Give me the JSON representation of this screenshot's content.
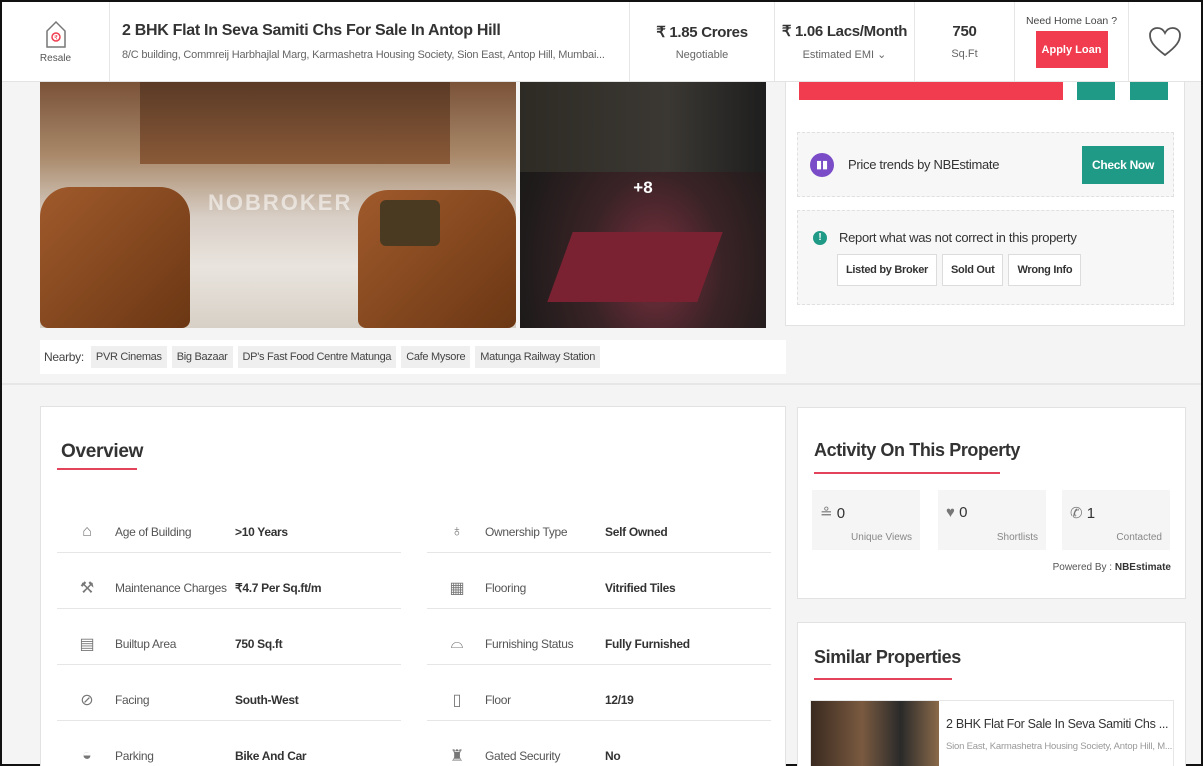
{
  "header": {
    "badge": "Resale",
    "title": "2 BHK Flat In Seva Samiti Chs For Sale In Antop Hill",
    "address": "8/C building, Commreij Harbhajlal Marg, Karmashetra Housing Society, Sion East, Antop Hill, Mumbai...",
    "price": "₹ 1.85 Crores",
    "price_note": "Negotiable",
    "emi": "₹ 1.06 Lacs/Month",
    "emi_note": "Estimated EMI ⌄",
    "area": "750",
    "area_unit": "Sq.Ft",
    "loan_question": "Need Home Loan ?",
    "loan_button": "Apply Loan"
  },
  "photos": {
    "watermark": "NOBROKER",
    "more_count": "+8"
  },
  "nearby": {
    "label": "Nearby:",
    "places": [
      "PVR Cinemas",
      "Big Bazaar",
      "DP's Fast Food Centre Matunga",
      "Cafe Mysore",
      "Matunga Railway Station"
    ]
  },
  "trends": {
    "text": "Price trends by NBEstimate",
    "button": "Check Now"
  },
  "report": {
    "text": "Report what was not correct in this property",
    "buttons": [
      "Listed by Broker",
      "Sold Out",
      "Wrong Info"
    ]
  },
  "overview": {
    "title": "Overview",
    "items": [
      {
        "icon": "building-age-icon",
        "label": "Age of Building",
        "value": ">10 Years"
      },
      {
        "icon": "ownership-icon",
        "label": "Ownership Type",
        "value": "Self Owned"
      },
      {
        "icon": "maintenance-icon",
        "label": "Maintenance Charges",
        "value": "₹4.7 Per Sq.ft/m"
      },
      {
        "icon": "flooring-icon",
        "label": "Flooring",
        "value": "Vitrified Tiles"
      },
      {
        "icon": "builtup-area-icon",
        "label": "Builtup Area",
        "value": "750 Sq.ft"
      },
      {
        "icon": "furnishing-icon",
        "label": "Furnishing Status",
        "value": "Fully Furnished"
      },
      {
        "icon": "compass-icon",
        "label": "Facing",
        "value": "South-West"
      },
      {
        "icon": "floor-icon",
        "label": "Floor",
        "value": "12/19"
      },
      {
        "icon": "car-icon",
        "label": "Parking",
        "value": "Bike And Car"
      },
      {
        "icon": "security-guard-icon",
        "label": "Gated Security",
        "value": "No"
      }
    ]
  },
  "activity": {
    "title": "Activity On This Property",
    "stats": [
      {
        "icon": "person-icon",
        "count": "0",
        "label": "Unique Views"
      },
      {
        "icon": "heart-icon",
        "count": "0",
        "label": "Shortlists"
      },
      {
        "icon": "phone-icon",
        "count": "1",
        "label": "Contacted"
      }
    ],
    "powered_label": "Powered By :",
    "powered_by": "NBEstimate"
  },
  "similar": {
    "title": "Similar Properties",
    "card_title": "2 BHK Flat For Sale In Seva Samiti Chs ...",
    "card_address": "Sion East, Karmashetra Housing Society, Antop Hill, M..."
  },
  "colors": {
    "accent_red": "#f03c4e",
    "accent_green": "#1f9a86",
    "underline": "#e4435c"
  }
}
